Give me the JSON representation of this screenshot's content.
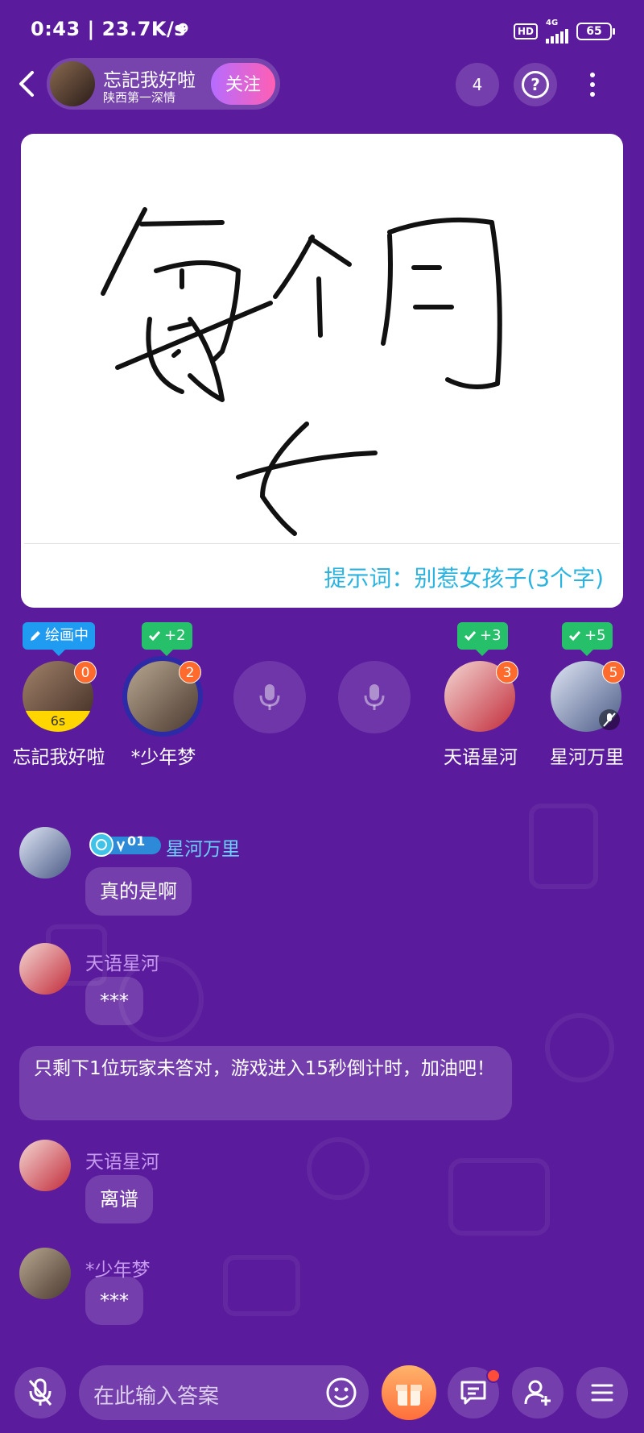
{
  "status_bar": {
    "time": "0:43 | 23.7K/s",
    "hd": "HD",
    "network": "4G",
    "battery": "65"
  },
  "header": {
    "host_name": "忘記我好啦",
    "host_subtitle": "陕西第一深情",
    "follow_label": "关注",
    "online_count": "4",
    "help_label": "?"
  },
  "canvas": {
    "hint": "提示词：别惹女孩子(3个字)"
  },
  "seats": {
    "drawing_tag": "绘画中",
    "s1": {
      "name": "忘記我好啦",
      "score": "0",
      "timer": "6s"
    },
    "s2": {
      "name": "*少年梦",
      "score": "2",
      "tag": "+2"
    },
    "s5": {
      "name": "天语星河",
      "score": "3",
      "tag": "+3"
    },
    "s6": {
      "name": "星河万里",
      "score": "5",
      "tag": "+5"
    }
  },
  "chat": {
    "m1": {
      "name": "星河万里",
      "level": "01",
      "text": "真的是啊"
    },
    "m2": {
      "name": "天语星河",
      "text": "***"
    },
    "system": "只剩下1位玩家未答对，游戏进入15秒倒计时，加油吧！",
    "m3": {
      "name": "天语星河",
      "text": "离谱"
    },
    "m4": {
      "name": "*少年梦",
      "text": "***"
    }
  },
  "bottom": {
    "input_placeholder": "在此输入答案"
  },
  "colors": {
    "background": "#5a1b9c",
    "hint": "#2bb3df",
    "follow_start": "#b66cff",
    "follow_end": "#ff5fb4",
    "badge": "#ff6b2c",
    "tag_green": "#27c06a",
    "tag_blue": "#1f9bf2"
  }
}
